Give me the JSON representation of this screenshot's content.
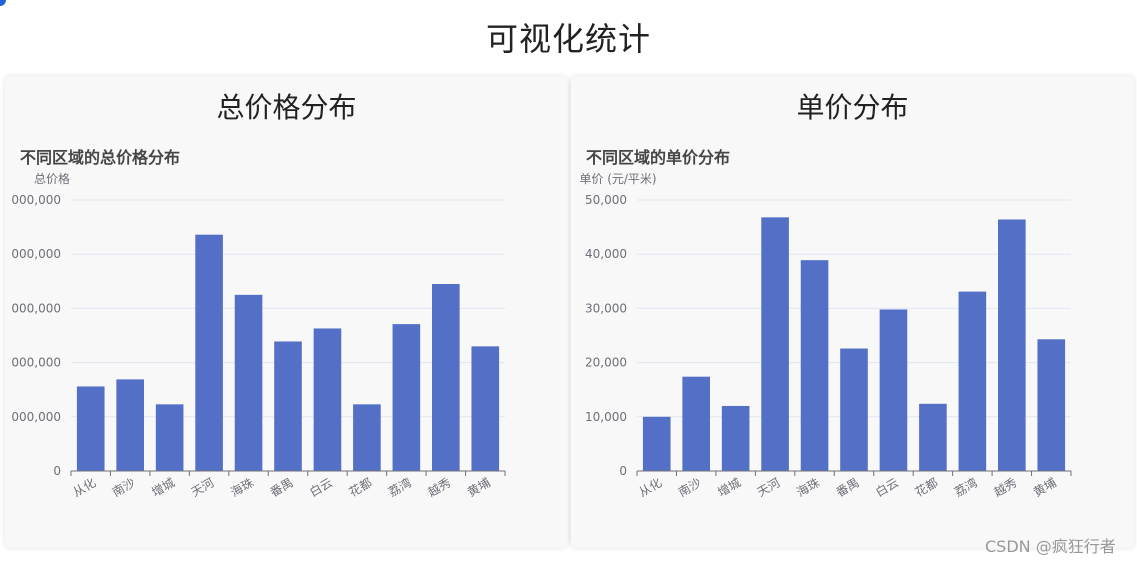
{
  "page": {
    "title": "可视化统计"
  },
  "panels": [
    {
      "heading": "总价格分布",
      "chart_title": "不同区域的总价格分布"
    },
    {
      "heading": "单价分布",
      "chart_title": "不同区域的单价分布"
    }
  ],
  "watermark": "CSDN @疯狂行者",
  "colors": {
    "bar": "#5470c6",
    "axis": "#6e7079",
    "grid": "#e0e6f1"
  },
  "chart_data": [
    {
      "type": "bar",
      "title": "不同区域的总价格分布",
      "ylabel": "总价格",
      "xlabel": "",
      "categories": [
        "从化",
        "南沙",
        "增城",
        "天河",
        "海珠",
        "番禺",
        "白云",
        "花都",
        "荔湾",
        "越秀",
        "黄埔"
      ],
      "values": [
        1560000,
        1690000,
        1230000,
        4360000,
        3250000,
        2390000,
        2630000,
        1230000,
        2710000,
        3450000,
        2300000
      ],
      "ylim": [
        0,
        5000000
      ],
      "yticks": [
        0,
        1000000,
        2000000,
        3000000,
        4000000,
        5000000
      ],
      "ytick_labels": [
        "0",
        "000,000",
        "000,000",
        "000,000",
        "000,000",
        "000,000"
      ],
      "grid": true
    },
    {
      "type": "bar",
      "title": "不同区域的单价分布",
      "ylabel": "单价 (元/平米)",
      "xlabel": "",
      "categories": [
        "从化",
        "南沙",
        "增城",
        "天河",
        "海珠",
        "番禺",
        "白云",
        "花都",
        "荔湾",
        "越秀",
        "黄埔"
      ],
      "values": [
        10000,
        17400,
        12000,
        46800,
        38900,
        22600,
        29800,
        12400,
        33100,
        46400,
        24300
      ],
      "ylim": [
        0,
        50000
      ],
      "yticks": [
        0,
        10000,
        20000,
        30000,
        40000,
        50000
      ],
      "ytick_labels": [
        "0",
        "10,000",
        "20,000",
        "30,000",
        "40,000",
        "50,000"
      ],
      "grid": true
    }
  ]
}
